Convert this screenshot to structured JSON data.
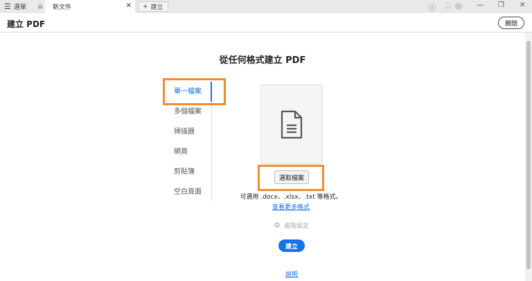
{
  "titlebar": {
    "menu_label": "選單",
    "tab_label": "新文件",
    "new_tab_label": "建立"
  },
  "header": {
    "title": "建立 PDF",
    "close_label": "關閉"
  },
  "main": {
    "heading": "從任何格式建立 PDF",
    "sources": [
      {
        "label": "單一檔案"
      },
      {
        "label": "多個檔案"
      },
      {
        "label": "掃描器"
      },
      {
        "label": "網頁"
      },
      {
        "label": "剪貼簿"
      },
      {
        "label": "空白頁面"
      }
    ],
    "select_file_label": "選取檔案",
    "formats_text": "可選用 .docx、.xlsx、.txt 等格式。",
    "more_formats_link": "查看更多格式",
    "advanced_label": "進階設定",
    "create_label": "建立",
    "help_link": "說明"
  },
  "colors": {
    "accent": "#1473e6",
    "highlight": "#f28a31"
  }
}
